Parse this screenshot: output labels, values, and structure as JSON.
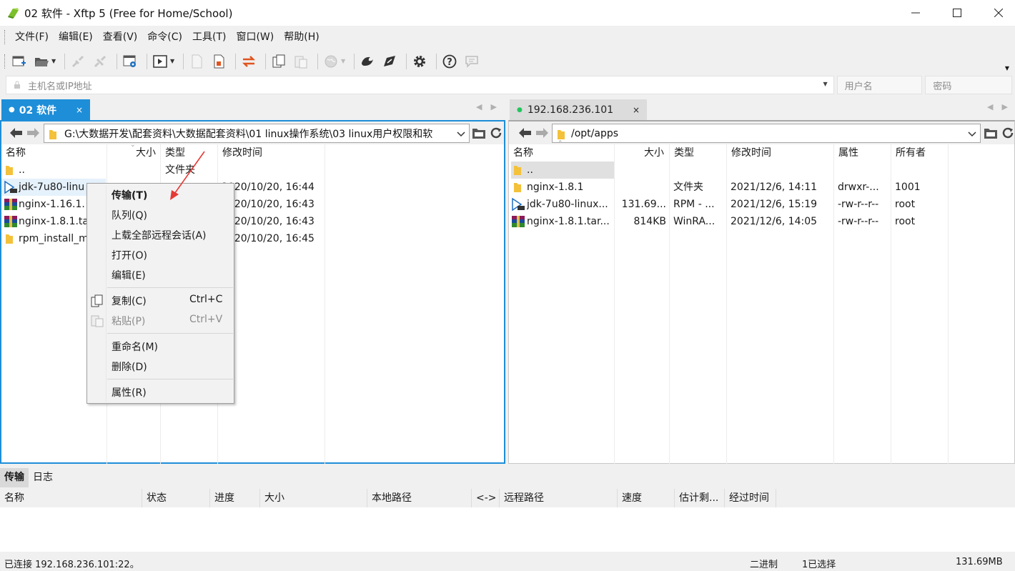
{
  "window": {
    "title": "02 软件 - Xftp 5 (Free for Home/School)"
  },
  "menu": [
    "文件(F)",
    "编辑(E)",
    "查看(V)",
    "命令(C)",
    "工具(T)",
    "窗口(W)",
    "帮助(H)"
  ],
  "address": {
    "host_placeholder": "主机名或IP地址",
    "user_placeholder": "用户名",
    "pass_placeholder": "密码"
  },
  "local": {
    "tab_label": "02 软件",
    "path": "G:\\大数据开发\\配套资料\\大数据配套资料\\01 linux操作系统\\03 linux用户权限和软",
    "columns": [
      "名称",
      "大小",
      "类型",
      "修改时间"
    ],
    "rows": [
      {
        "name": "..",
        "size": "",
        "type": "文件夹",
        "mtime": ""
      },
      {
        "name": "jdk-7u80-linu",
        "size": "",
        "type": "",
        "mtime": "2020/10/20, 16:44"
      },
      {
        "name": "nginx-1.16.1.",
        "size": "",
        "type": "",
        "mtime": "2020/10/20, 16:43"
      },
      {
        "name": "nginx-1.8.1.ta",
        "size": "",
        "type": "",
        "mtime": "2020/10/20, 16:43"
      },
      {
        "name": "rpm_install_m",
        "size": "",
        "type": "",
        "mtime": "2020/10/20, 16:45"
      }
    ]
  },
  "remote": {
    "tab_label": "192.168.236.101",
    "path": "/opt/apps",
    "columns": [
      "名称",
      "大小",
      "类型",
      "修改时间",
      "属性",
      "所有者"
    ],
    "rows": [
      {
        "name": "..",
        "size": "",
        "type": "",
        "mtime": "",
        "attr": "",
        "owner": ""
      },
      {
        "name": "nginx-1.8.1",
        "size": "",
        "type": "文件夹",
        "mtime": "2021/12/6, 14:11",
        "attr": "drwxr-...",
        "owner": "1001"
      },
      {
        "name": "jdk-7u80-linux...",
        "size": "131.69...",
        "type": "RPM - ...",
        "mtime": "2021/12/6, 15:19",
        "attr": "-rw-r--r--",
        "owner": "root"
      },
      {
        "name": "nginx-1.8.1.tar...",
        "size": "814KB",
        "type": "WinRA...",
        "mtime": "2021/12/6, 14:05",
        "attr": "-rw-r--r--",
        "owner": "root"
      }
    ]
  },
  "context_menu": [
    {
      "label": "传输(T)",
      "shortcut": ""
    },
    {
      "label": "队列(Q)",
      "shortcut": ""
    },
    {
      "label": "上载全部远程会话(A)",
      "shortcut": ""
    },
    {
      "label": "打开(O)",
      "shortcut": ""
    },
    {
      "label": "编辑(E)",
      "shortcut": ""
    },
    {
      "label": "复制(C)",
      "shortcut": "Ctrl+C"
    },
    {
      "label": "粘贴(P)",
      "shortcut": "Ctrl+V"
    },
    {
      "label": "重命名(M)",
      "shortcut": ""
    },
    {
      "label": "删除(D)",
      "shortcut": ""
    },
    {
      "label": "属性(R)",
      "shortcut": ""
    }
  ],
  "bottom": {
    "tabs": [
      "传输",
      "日志"
    ],
    "columns": [
      "名称",
      "状态",
      "进度",
      "大小",
      "本地路径",
      "<->",
      "远程路径",
      "速度",
      "估计剩...",
      "经过时间"
    ]
  },
  "status": {
    "connection": "已连接 192.168.236.101:22。",
    "mode": "二进制",
    "selection": "1已选择",
    "size": "131.69MB"
  },
  "colors": {
    "accent": "#1e8ed8",
    "connected_dot": "#22c55e",
    "annotation_arrow": "#e53935"
  }
}
